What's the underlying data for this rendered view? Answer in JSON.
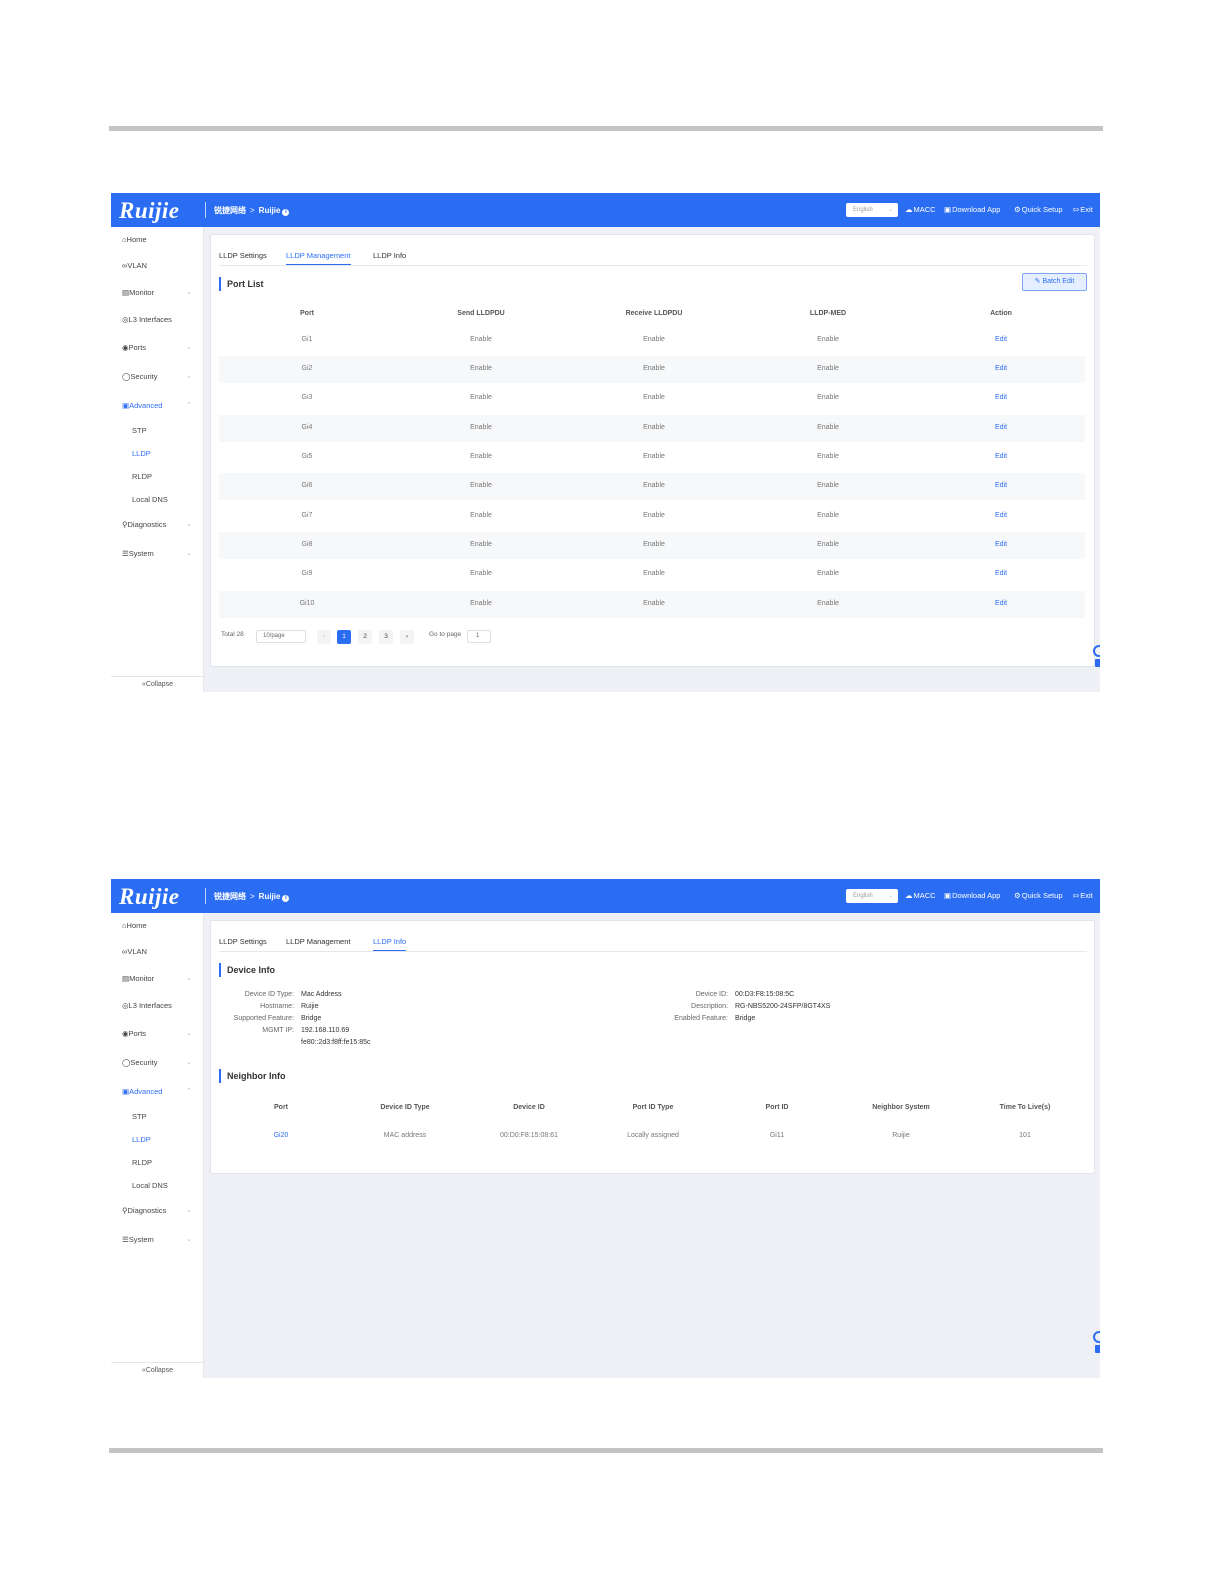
{
  "header": {
    "logo": "Ruijie",
    "crumb_group": "锐捷网络",
    "crumb_sep": ">",
    "crumb_device": "Ruijie",
    "language": "English",
    "links": {
      "macc": "MACC",
      "download_app": "Download App",
      "quick_setup": "Quick Setup",
      "exit": "Exit"
    }
  },
  "sidebar": {
    "items": [
      {
        "label": "Home",
        "icon": "home-icon"
      },
      {
        "label": "VLAN",
        "icon": "vlan-icon"
      },
      {
        "label": "Monitor",
        "icon": "monitor-icon"
      },
      {
        "label": "L3 Interfaces",
        "icon": "globe-icon"
      },
      {
        "label": "Ports",
        "icon": "ports-icon"
      },
      {
        "label": "Security",
        "icon": "shield-icon"
      },
      {
        "label": "Advanced",
        "icon": "toolbox-icon"
      },
      {
        "label": "Diagnostics",
        "icon": "search-icon"
      },
      {
        "label": "System",
        "icon": "sliders-icon"
      }
    ],
    "advanced_sub": [
      "STP",
      "LLDP",
      "RLDP",
      "Local DNS"
    ],
    "collapse": "Collapse"
  },
  "tabs": [
    "LLDP Settings",
    "LLDP Management",
    "LLDP Info"
  ],
  "management": {
    "section_title": "Port List",
    "batch_edit": "Batch Edit",
    "columns": [
      "Port",
      "Send LLDPDU",
      "Receive LLDPDU",
      "LLDP-MED",
      "Action"
    ],
    "rows": [
      [
        "Gi1",
        "Enable",
        "Enable",
        "Enable",
        "Edit"
      ],
      [
        "Gi2",
        "Enable",
        "Enable",
        "Enable",
        "Edit"
      ],
      [
        "Gi3",
        "Enable",
        "Enable",
        "Enable",
        "Edit"
      ],
      [
        "Gi4",
        "Enable",
        "Enable",
        "Enable",
        "Edit"
      ],
      [
        "Gi5",
        "Enable",
        "Enable",
        "Enable",
        "Edit"
      ],
      [
        "Gi6",
        "Enable",
        "Enable",
        "Enable",
        "Edit"
      ],
      [
        "Gi7",
        "Enable",
        "Enable",
        "Enable",
        "Edit"
      ],
      [
        "Gi8",
        "Enable",
        "Enable",
        "Enable",
        "Edit"
      ],
      [
        "Gi9",
        "Enable",
        "Enable",
        "Enable",
        "Edit"
      ],
      [
        "Gi10",
        "Enable",
        "Enable",
        "Enable",
        "Edit"
      ]
    ],
    "pagination": {
      "total": "Total 28",
      "page_size": "10/page",
      "pages": [
        "1",
        "2",
        "3"
      ],
      "current": "1",
      "go_to": "Go to page",
      "jump_value": "1"
    }
  },
  "info": {
    "device_section": "Device Info",
    "left_fields": [
      {
        "label": "Device ID Type:",
        "value": "Mac Address"
      },
      {
        "label": "Hostname:",
        "value": "Ruijie"
      },
      {
        "label": "Supported Feature:",
        "value": "Bridge"
      },
      {
        "label": "MGMT IP:",
        "value": "192.168.110.69"
      },
      {
        "label": "",
        "value": "fe80::2d3:f8ff:fe15:85c"
      }
    ],
    "right_fields": [
      {
        "label": "Device ID:",
        "value": "00:D3:F8:15:08:5C"
      },
      {
        "label": "Description:",
        "value": "RG-NBS5200-24SFP/8GT4XS"
      },
      {
        "label": "Enabled Feature:",
        "value": "Bridge"
      }
    ],
    "neighbor_section": "Neighbor Info",
    "neighbor_columns": [
      "Port",
      "Device ID Type",
      "Device ID",
      "Port ID Type",
      "Port ID",
      "Neighbor System",
      "Time To Live(s)"
    ],
    "neighbor_rows": [
      [
        "Gi20",
        "MAC address",
        "00:D0:F8:15:08:61",
        "Locally assigned",
        "Gi11",
        "Ruijie",
        "101"
      ]
    ]
  },
  "colors": {
    "primary": "#2b6df2",
    "header_bg": "#2b6df2",
    "page_bg": "#eef0f5"
  }
}
